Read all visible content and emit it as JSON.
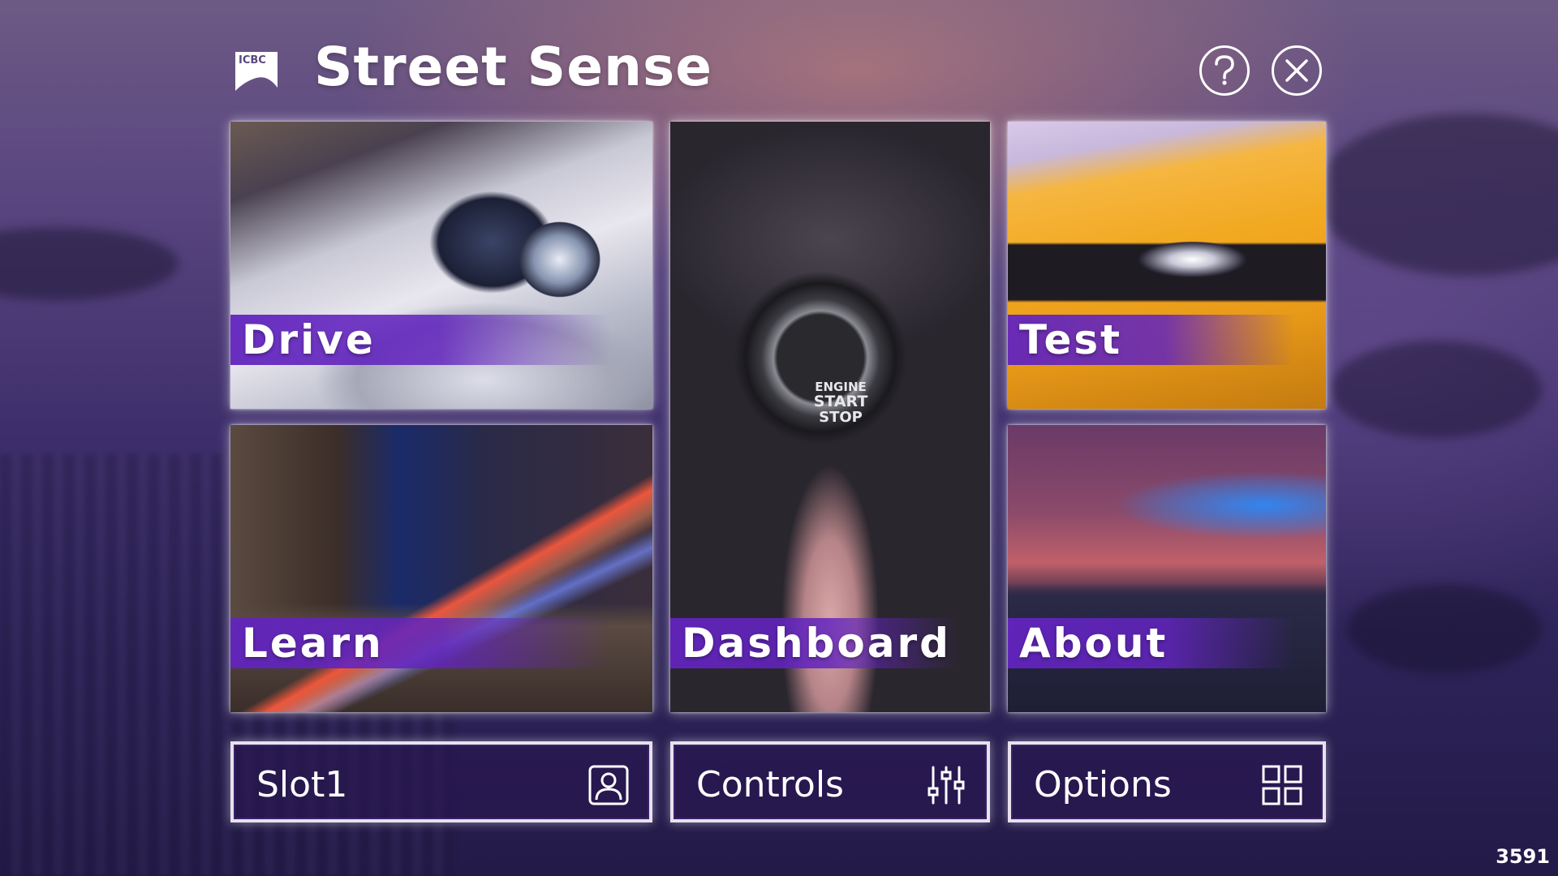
{
  "header": {
    "logo_text": "ICBC",
    "title": "Street Sense",
    "help_icon": "question-mark-icon",
    "close_icon": "close-x-icon"
  },
  "tiles": {
    "drive": {
      "label": "Drive"
    },
    "dashboard": {
      "label": "Dashboard",
      "button_text_1": "ENGINE",
      "button_text_2": "START",
      "button_text_3": "STOP"
    },
    "test": {
      "label": "Test"
    },
    "learn": {
      "label": "Learn"
    },
    "about": {
      "label": "About"
    }
  },
  "bottom_buttons": {
    "slot": {
      "label": "Slot1",
      "icon": "user-profile-icon"
    },
    "controls": {
      "label": "Controls",
      "icon": "sliders-icon"
    },
    "options": {
      "label": "Options",
      "icon": "grid-icon"
    }
  },
  "corner_number": "3591",
  "colors": {
    "label_band": "#6224BE",
    "text": "#FFFFFF",
    "border": "#E6E2EE"
  }
}
